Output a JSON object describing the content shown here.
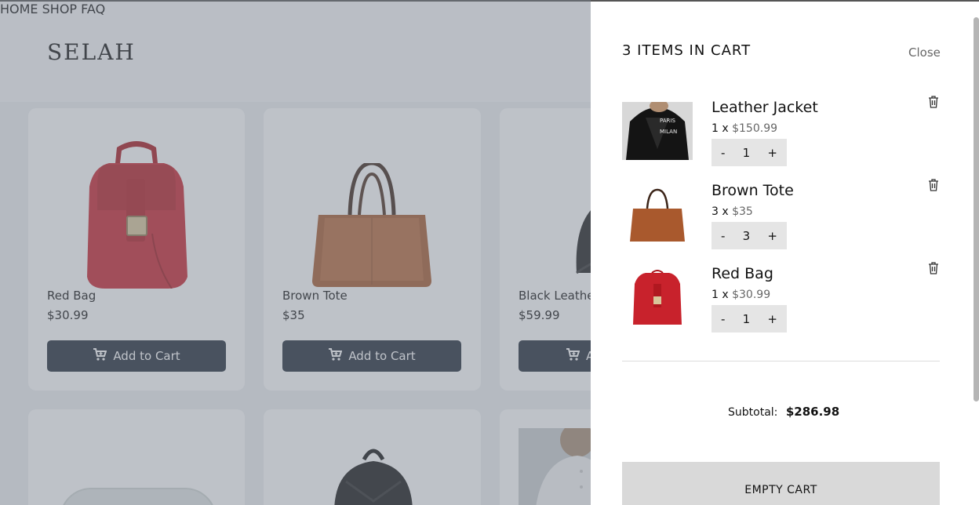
{
  "header": {
    "brand": "SELAH",
    "nav": [
      "HOME",
      "SHOP",
      "FAQ"
    ]
  },
  "products": [
    {
      "name": "Red Bag",
      "price": "$30.99",
      "button": "Add to Cart",
      "image": "red-backpack"
    },
    {
      "name": "Brown Tote",
      "price": "$35",
      "button": "Add to Cart",
      "image": "brown-tote"
    },
    {
      "name": "Black Leathe",
      "price": "$59.99",
      "button": "A",
      "image": "black-cap"
    }
  ],
  "cart": {
    "title": "3 ITEMS IN CART",
    "close_label": "Close",
    "items": [
      {
        "name": "Leather Jacket",
        "qty_prefix": "1 x",
        "unit_price": "$150.99",
        "qty": "1",
        "minus": "-",
        "plus": "+",
        "image": "leather-jacket"
      },
      {
        "name": "Brown Tote",
        "qty_prefix": "3 x",
        "unit_price": "$35",
        "qty": "3",
        "minus": "-",
        "plus": "+",
        "image": "brown-tote"
      },
      {
        "name": "Red Bag",
        "qty_prefix": "1 x",
        "unit_price": "$30.99",
        "qty": "1",
        "minus": "-",
        "plus": "+",
        "image": "red-backpack"
      }
    ],
    "subtotal_label": "Subtotal:",
    "subtotal_value": "$286.98",
    "empty_label": "EMPTY CART"
  },
  "colors": {
    "button_dark": "#1f2937",
    "overlay": "#787f8c",
    "muted_price": "#666666"
  }
}
